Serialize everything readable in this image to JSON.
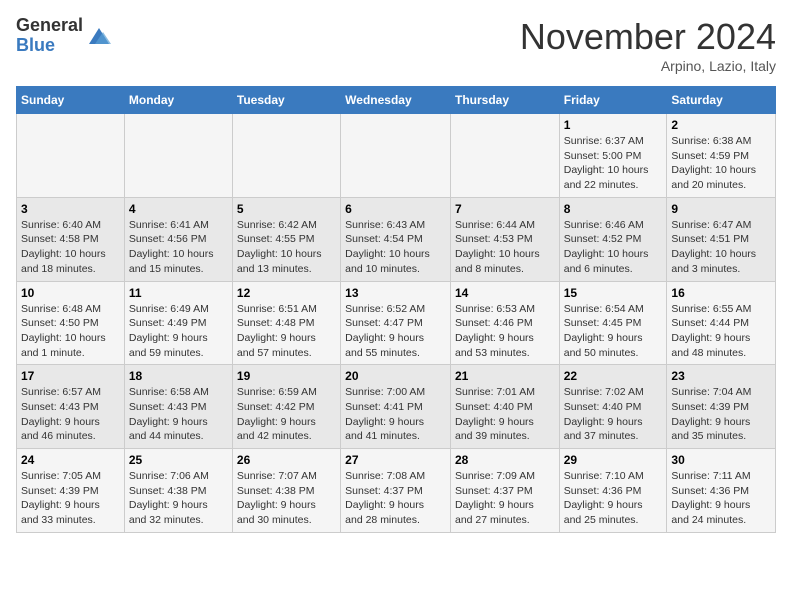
{
  "header": {
    "logo_line1": "General",
    "logo_line2": "Blue",
    "month_title": "November 2024",
    "location": "Arpino, Lazio, Italy"
  },
  "days_of_week": [
    "Sunday",
    "Monday",
    "Tuesday",
    "Wednesday",
    "Thursday",
    "Friday",
    "Saturday"
  ],
  "weeks": [
    [
      {
        "day": "",
        "info": ""
      },
      {
        "day": "",
        "info": ""
      },
      {
        "day": "",
        "info": ""
      },
      {
        "day": "",
        "info": ""
      },
      {
        "day": "",
        "info": ""
      },
      {
        "day": "1",
        "info": "Sunrise: 6:37 AM\nSunset: 5:00 PM\nDaylight: 10 hours\nand 22 minutes."
      },
      {
        "day": "2",
        "info": "Sunrise: 6:38 AM\nSunset: 4:59 PM\nDaylight: 10 hours\nand 20 minutes."
      }
    ],
    [
      {
        "day": "3",
        "info": "Sunrise: 6:40 AM\nSunset: 4:58 PM\nDaylight: 10 hours\nand 18 minutes."
      },
      {
        "day": "4",
        "info": "Sunrise: 6:41 AM\nSunset: 4:56 PM\nDaylight: 10 hours\nand 15 minutes."
      },
      {
        "day": "5",
        "info": "Sunrise: 6:42 AM\nSunset: 4:55 PM\nDaylight: 10 hours\nand 13 minutes."
      },
      {
        "day": "6",
        "info": "Sunrise: 6:43 AM\nSunset: 4:54 PM\nDaylight: 10 hours\nand 10 minutes."
      },
      {
        "day": "7",
        "info": "Sunrise: 6:44 AM\nSunset: 4:53 PM\nDaylight: 10 hours\nand 8 minutes."
      },
      {
        "day": "8",
        "info": "Sunrise: 6:46 AM\nSunset: 4:52 PM\nDaylight: 10 hours\nand 6 minutes."
      },
      {
        "day": "9",
        "info": "Sunrise: 6:47 AM\nSunset: 4:51 PM\nDaylight: 10 hours\nand 3 minutes."
      }
    ],
    [
      {
        "day": "10",
        "info": "Sunrise: 6:48 AM\nSunset: 4:50 PM\nDaylight: 10 hours\nand 1 minute."
      },
      {
        "day": "11",
        "info": "Sunrise: 6:49 AM\nSunset: 4:49 PM\nDaylight: 9 hours\nand 59 minutes."
      },
      {
        "day": "12",
        "info": "Sunrise: 6:51 AM\nSunset: 4:48 PM\nDaylight: 9 hours\nand 57 minutes."
      },
      {
        "day": "13",
        "info": "Sunrise: 6:52 AM\nSunset: 4:47 PM\nDaylight: 9 hours\nand 55 minutes."
      },
      {
        "day": "14",
        "info": "Sunrise: 6:53 AM\nSunset: 4:46 PM\nDaylight: 9 hours\nand 53 minutes."
      },
      {
        "day": "15",
        "info": "Sunrise: 6:54 AM\nSunset: 4:45 PM\nDaylight: 9 hours\nand 50 minutes."
      },
      {
        "day": "16",
        "info": "Sunrise: 6:55 AM\nSunset: 4:44 PM\nDaylight: 9 hours\nand 48 minutes."
      }
    ],
    [
      {
        "day": "17",
        "info": "Sunrise: 6:57 AM\nSunset: 4:43 PM\nDaylight: 9 hours\nand 46 minutes."
      },
      {
        "day": "18",
        "info": "Sunrise: 6:58 AM\nSunset: 4:43 PM\nDaylight: 9 hours\nand 44 minutes."
      },
      {
        "day": "19",
        "info": "Sunrise: 6:59 AM\nSunset: 4:42 PM\nDaylight: 9 hours\nand 42 minutes."
      },
      {
        "day": "20",
        "info": "Sunrise: 7:00 AM\nSunset: 4:41 PM\nDaylight: 9 hours\nand 41 minutes."
      },
      {
        "day": "21",
        "info": "Sunrise: 7:01 AM\nSunset: 4:40 PM\nDaylight: 9 hours\nand 39 minutes."
      },
      {
        "day": "22",
        "info": "Sunrise: 7:02 AM\nSunset: 4:40 PM\nDaylight: 9 hours\nand 37 minutes."
      },
      {
        "day": "23",
        "info": "Sunrise: 7:04 AM\nSunset: 4:39 PM\nDaylight: 9 hours\nand 35 minutes."
      }
    ],
    [
      {
        "day": "24",
        "info": "Sunrise: 7:05 AM\nSunset: 4:39 PM\nDaylight: 9 hours\nand 33 minutes."
      },
      {
        "day": "25",
        "info": "Sunrise: 7:06 AM\nSunset: 4:38 PM\nDaylight: 9 hours\nand 32 minutes."
      },
      {
        "day": "26",
        "info": "Sunrise: 7:07 AM\nSunset: 4:38 PM\nDaylight: 9 hours\nand 30 minutes."
      },
      {
        "day": "27",
        "info": "Sunrise: 7:08 AM\nSunset: 4:37 PM\nDaylight: 9 hours\nand 28 minutes."
      },
      {
        "day": "28",
        "info": "Sunrise: 7:09 AM\nSunset: 4:37 PM\nDaylight: 9 hours\nand 27 minutes."
      },
      {
        "day": "29",
        "info": "Sunrise: 7:10 AM\nSunset: 4:36 PM\nDaylight: 9 hours\nand 25 minutes."
      },
      {
        "day": "30",
        "info": "Sunrise: 7:11 AM\nSunset: 4:36 PM\nDaylight: 9 hours\nand 24 minutes."
      }
    ]
  ]
}
